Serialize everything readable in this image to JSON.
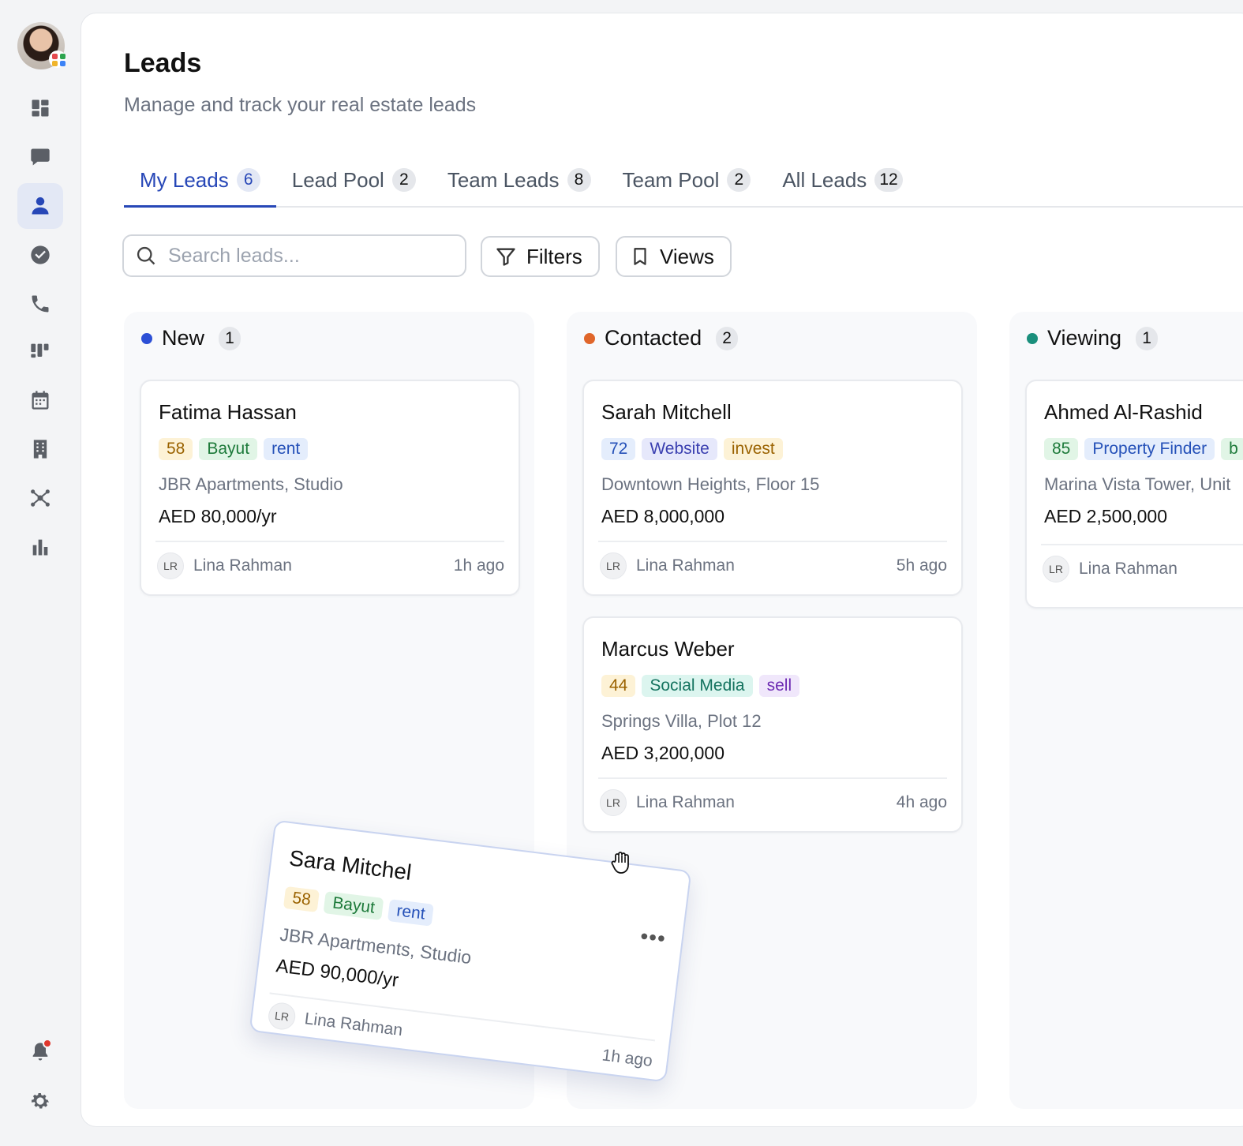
{
  "page": {
    "title": "Leads",
    "subtitle": "Manage and track your real estate leads"
  },
  "tabs": [
    {
      "label": "My Leads",
      "count": "6"
    },
    {
      "label": "Lead Pool",
      "count": "2"
    },
    {
      "label": "Team Leads",
      "count": "8"
    },
    {
      "label": "Team Pool",
      "count": "2"
    },
    {
      "label": "All Leads",
      "count": "12"
    }
  ],
  "toolbar": {
    "search_placeholder": "Search leads...",
    "filters_label": "Filters",
    "views_label": "Views"
  },
  "sidebar": {
    "items": [
      "dashboard-icon",
      "chat-icon",
      "user-icon",
      "check-circle-icon",
      "phone-icon",
      "kanban-icon",
      "calendar-icon",
      "building-icon",
      "network-icon",
      "bar-chart-icon"
    ],
    "bottom": [
      "bell-icon",
      "gear-icon"
    ]
  },
  "columns": [
    {
      "name": "New",
      "count": "1",
      "color": "#2c4fd6",
      "cards": [
        {
          "name": "Fatima Hassan",
          "score": "58",
          "source": "Bayut",
          "type": "rent",
          "property": "JBR Apartments, Studio",
          "price": "AED 80,000/yr",
          "initials": "LR",
          "agent": "Lina Rahman",
          "time": "1h ago"
        }
      ]
    },
    {
      "name": "Contacted",
      "count": "2",
      "color": "#e0662a",
      "cards": [
        {
          "name": "Sarah Mitchell",
          "score": "72",
          "source": "Website",
          "type": "invest",
          "property": "Downtown Heights, Floor 15",
          "price": "AED 8,000,000",
          "initials": "LR",
          "agent": "Lina Rahman",
          "time": "5h ago"
        },
        {
          "name": "Marcus Weber",
          "score": "44",
          "source": "Social Media",
          "type": "sell",
          "property": "Springs Villa, Plot 12",
          "price": "AED 3,200,000",
          "initials": "LR",
          "agent": "Lina Rahman",
          "time": "4h ago"
        }
      ]
    },
    {
      "name": "Viewing",
      "count": "1",
      "color": "#1a8f7c",
      "cards": [
        {
          "name": "Ahmed Al-Rashid",
          "score": "85",
          "source": "Property Finder",
          "type": "b",
          "property": "Marina Vista Tower, Unit",
          "price": "AED 2,500,000",
          "initials": "LR",
          "agent": "Lina Rahman",
          "time": ""
        }
      ]
    }
  ],
  "dragging_card": {
    "name": "Sara Mitchel",
    "score": "58",
    "source": "Bayut",
    "type": "rent",
    "property": "JBR Apartments, Studio",
    "price": "AED 90,000/yr",
    "initials": "LR",
    "agent": "Lina Rahman",
    "time": "1h ago",
    "more": "•••"
  },
  "colors": {
    "accent": "#2747b7",
    "notification": "#e0362c"
  }
}
